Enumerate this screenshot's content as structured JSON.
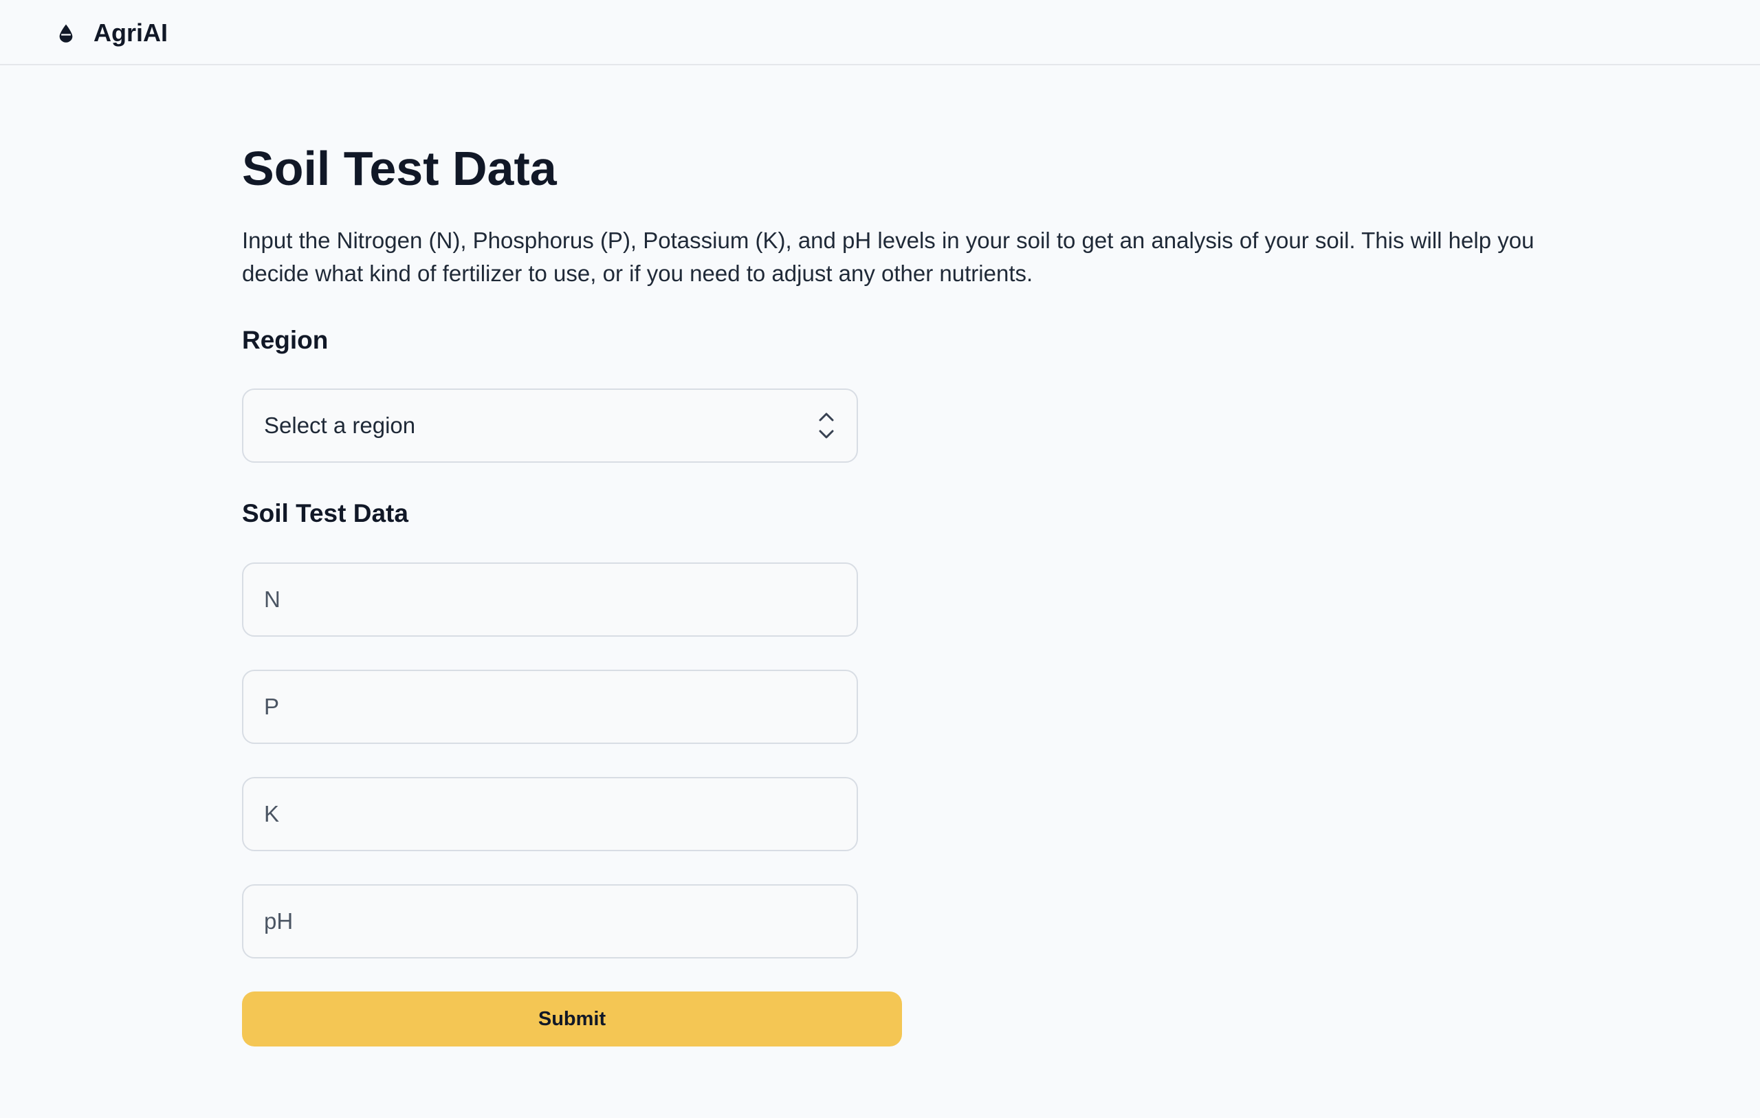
{
  "header": {
    "brand_icon": "drop-icon",
    "brand_name": "AgriAI"
  },
  "main": {
    "title": "Soil Test Data",
    "description": "Input the Nitrogen (N), Phosphorus (P), Potassium (K), and pH levels in your soil to get an analysis of your soil. This will help you decide what kind of fertilizer to use, or if you need to adjust any other nutrients.",
    "region": {
      "label": "Region",
      "placeholder": "Select a region",
      "icon": "chevron-up-down-icon"
    },
    "soil_section": {
      "label": "Soil Test Data",
      "fields": {
        "n": {
          "placeholder": "N",
          "value": ""
        },
        "p": {
          "placeholder": "P",
          "value": ""
        },
        "k": {
          "placeholder": "K",
          "value": ""
        },
        "ph": {
          "placeholder": "pH",
          "value": ""
        }
      }
    },
    "submit_label": "Submit"
  },
  "colors": {
    "background": "#f8fafc",
    "accent": "#f4c654",
    "text": "#111827",
    "border": "#d8dde4"
  }
}
